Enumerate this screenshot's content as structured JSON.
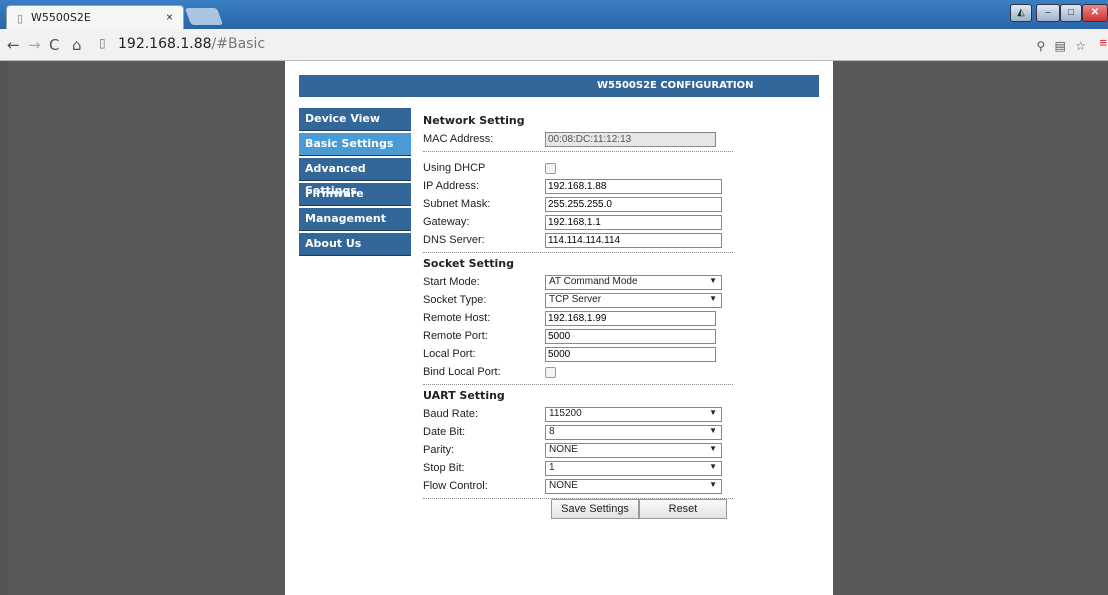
{
  "browser": {
    "tab_title": "W5500S2E",
    "tab_close": "×",
    "url_host": "192.168.1.88",
    "url_path": "/#Basic"
  },
  "page": {
    "header_title": "W5500S2E CONFIGURATION",
    "nav": [
      {
        "label": "Device View"
      },
      {
        "label": "Basic Settings"
      },
      {
        "label": "Advanced Settings"
      },
      {
        "label": "Firmware"
      },
      {
        "label": "Management"
      },
      {
        "label": "About Us"
      }
    ],
    "network": {
      "title": "Network Setting",
      "mac_label": "MAC Address:",
      "mac_value": "00:08:DC:11:12:13",
      "dhcp_label": "Using DHCP",
      "ip_label": "IP Address:",
      "ip_value": "192.168.1.88",
      "mask_label": "Subnet Mask:",
      "mask_value": "255.255.255.0",
      "gateway_label": "Gateway:",
      "gateway_value": "192.168.1.1",
      "dns_label": "DNS Server:",
      "dns_value": "114.114.114.114"
    },
    "socket": {
      "title": "Socket Setting",
      "start_mode_label": "Start Mode:",
      "start_mode_value": "AT Command Mode",
      "socket_type_label": "Socket Type:",
      "socket_type_value": "TCP Server",
      "remote_host_label": "Remote Host:",
      "remote_host_value": "192.168.1.99",
      "remote_port_label": "Remote Port:",
      "remote_port_value": "5000",
      "local_port_label": "Local Port:",
      "local_port_value": "5000",
      "bind_label": "Bind Local Port:"
    },
    "uart": {
      "title": "UART Setting",
      "baud_label": "Baud Rate:",
      "baud_value": "115200",
      "data_bit_label": "Date Bit:",
      "data_bit_value": "8",
      "parity_label": "Parity:",
      "parity_value": "NONE",
      "stop_bit_label": "Stop Bit:",
      "stop_bit_value": "1",
      "flow_label": "Flow Control:",
      "flow_value": "NONE"
    },
    "buttons": {
      "save": "Save Settings",
      "reset": "Reset"
    }
  }
}
